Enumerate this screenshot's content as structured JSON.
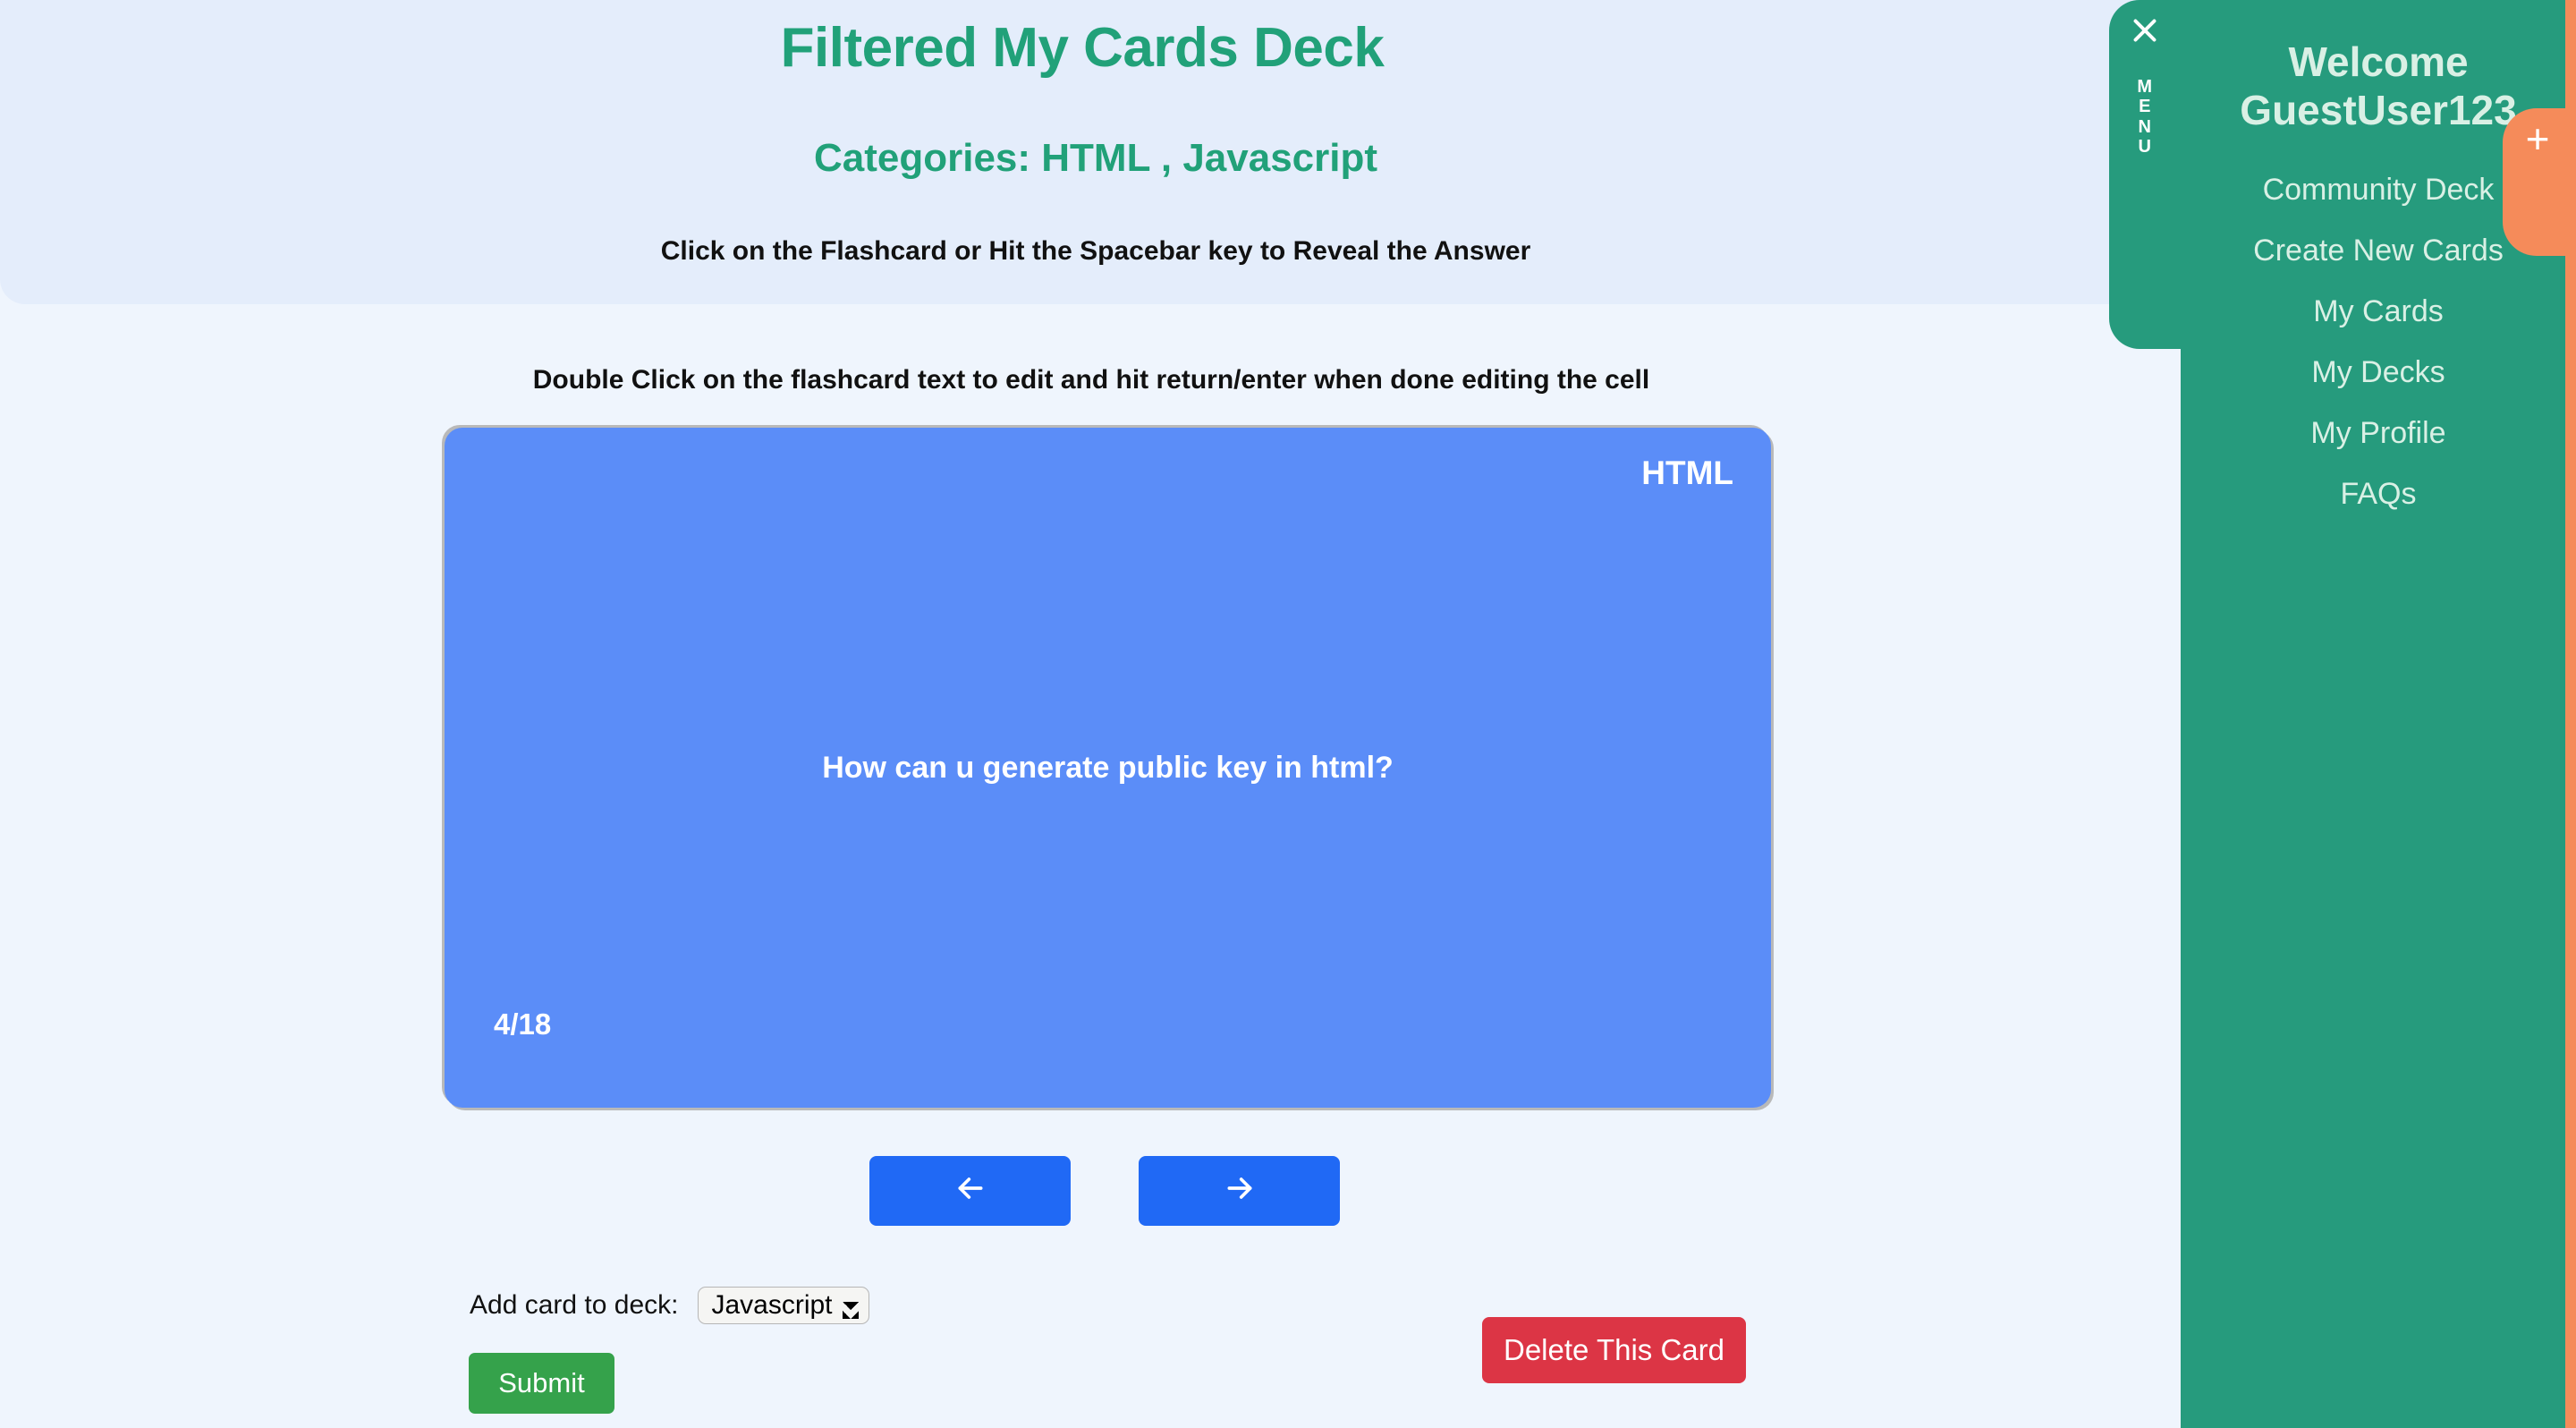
{
  "page": {
    "title": "Filtered My Cards Deck",
    "categories_line": "Categories: HTML , Javascript",
    "reveal_hint": "Click on the Flashcard or Hit the Spacebar key to Reveal the Answer",
    "edit_hint": "Double Click on the flashcard text to edit and hit return/enter when done editing the cell",
    "background_color": "#eff5fd",
    "header_band_color": "#e4edfb",
    "accent_green": "#21a179"
  },
  "flashcard": {
    "category_tag": "HTML",
    "question": "How can u generate public key in html?",
    "counter": "4/18",
    "current_index": 4,
    "total": 18,
    "background_color": "#5b8df8",
    "text_color": "#ffffff"
  },
  "navigation": {
    "prev_icon": "arrow-left-icon",
    "next_icon": "arrow-right-icon",
    "button_color": "#2069f5"
  },
  "controls": {
    "add_to_deck_label": "Add card to deck:",
    "deck_select_value": "Javascript",
    "deck_select_options": [
      "Javascript"
    ],
    "submit_label": "Submit",
    "submit_color": "#35a24b",
    "delete_label": "Delete This Card",
    "delete_color": "#dc3545"
  },
  "sidebar": {
    "menu_tab_label": "MENU",
    "close_icon": "close-x-icon",
    "welcome_title": "Welcome GuestUser123",
    "background_color": "#269b7d",
    "text_color": "#d9f0e5",
    "items": [
      {
        "label": "Community Deck"
      },
      {
        "label": "Create New Cards"
      },
      {
        "label": "My Cards"
      },
      {
        "label": "My Decks"
      },
      {
        "label": "My Profile"
      },
      {
        "label": "FAQs"
      }
    ],
    "add_tab": {
      "icon": "plus-icon",
      "glyph": "+",
      "color": "#f58b5a"
    }
  }
}
